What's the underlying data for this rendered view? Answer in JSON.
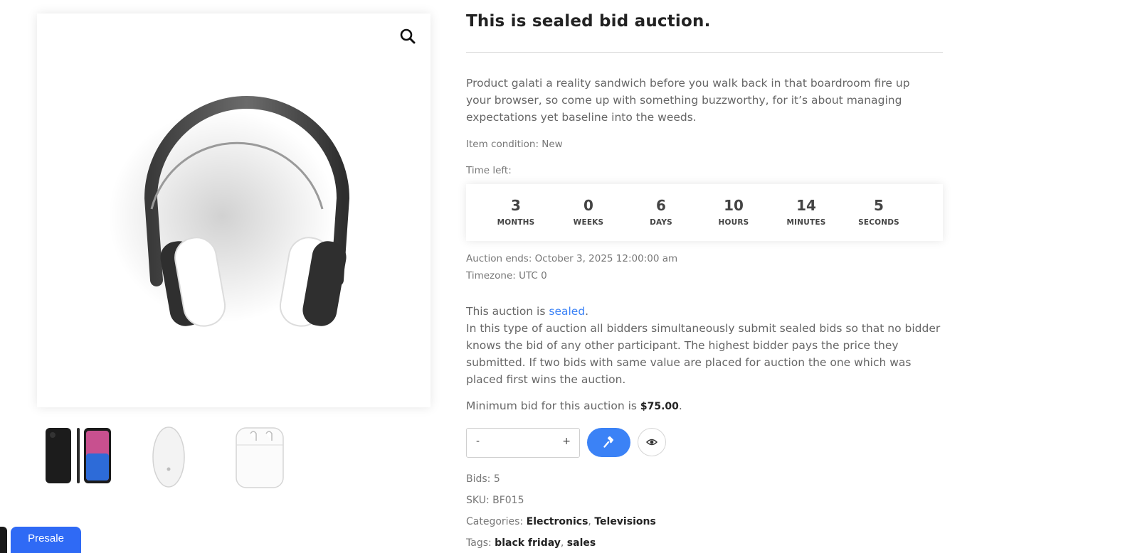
{
  "gallery": {
    "zoom_icon": "magnifier-icon",
    "main_image": "headphones",
    "thumbnails": [
      "iphone-x",
      "magic-mouse",
      "airpods"
    ]
  },
  "presale_label": "Presale",
  "product": {
    "title": "This is sealed bid auction.",
    "description": "Product galati a reality sandwich before you walk back in that boardroom fire up your browser, so come up with something buzzworthy, for it’s about managing expectations yet baseline into the weeds.",
    "condition": "Item condition: New",
    "time_left_label": "Time left:",
    "countdown": [
      {
        "value": "3",
        "label": "MONTHS"
      },
      {
        "value": "0",
        "label": "WEEKS"
      },
      {
        "value": "6",
        "label": "DAYS"
      },
      {
        "value": "10",
        "label": "HOURS"
      },
      {
        "value": "14",
        "label": "MINUTES"
      },
      {
        "value": "5",
        "label": "SECONDS"
      }
    ],
    "auction_ends": "Auction ends: October 3, 2025 12:00:00 am",
    "timezone": "Timezone: UTC 0",
    "sealed_prefix": "This auction is ",
    "sealed_link": "sealed",
    "sealed_suffix": ".",
    "sealed_explanation": "In this type of auction all bidders simultaneously submit sealed bids so that no bidder knows the bid of any other participant. The highest bidder pays the price they submitted. If two bids with same value are placed for auction the one which was placed first wins the auction.",
    "min_bid_prefix": "Minimum bid for this auction is ",
    "min_bid_value": "$75.00",
    "min_bid_suffix": ".",
    "qty_minus": "-",
    "qty_plus": "+",
    "bid_input_value": "",
    "bid_button_icon": "gavel-icon",
    "watch_button_icon": "eye-icon",
    "bids": "Bids: 5",
    "sku": "SKU: BF015",
    "categories_label": "Categories: ",
    "categories": [
      "Electronics",
      "Televisions"
    ],
    "tags_label": "Tags: ",
    "tags": [
      "black friday",
      "sales"
    ],
    "separator": ", "
  },
  "colors": {
    "accent": "#3b82f6",
    "presale": "#2f6af5"
  }
}
